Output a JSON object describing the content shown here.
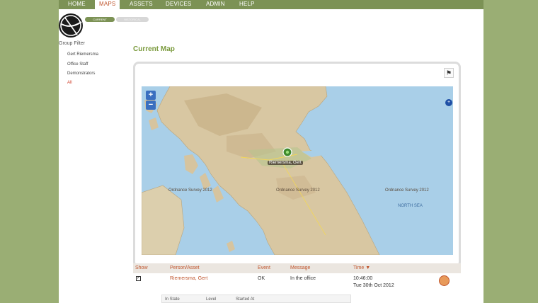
{
  "nav": {
    "items": [
      {
        "label": "HOME"
      },
      {
        "label": "MAPS"
      },
      {
        "label": "ASSETS"
      },
      {
        "label": "DEVICES"
      },
      {
        "label": "ADMIN"
      },
      {
        "label": "HELP"
      }
    ],
    "active_index": 1,
    "accent_color": "#c0562e",
    "bar_color": "#7c9255"
  },
  "view_toggle": {
    "current_label": "CURRENT",
    "historical_label": "HISTORICAL"
  },
  "group_filter": {
    "title": "Group Filter",
    "items": [
      {
        "label": "Gert Riemersma"
      },
      {
        "label": "Office Staff"
      },
      {
        "label": "Demonstrators"
      },
      {
        "label": "All"
      }
    ]
  },
  "map": {
    "title": "Current Map",
    "zoom_in": "+",
    "zoom_out": "−",
    "marker_label": "Riemersma, Gert",
    "attributions": [
      "Ordnance Survey 2012",
      "Ordnance Survey 2012",
      "Ordnance Survey 2012"
    ],
    "sea_label": "NORTH SEA",
    "layer_icon": "plus",
    "export_icon": "flag-icon"
  },
  "table": {
    "headers": {
      "show": "Show",
      "person": "Person/Asset",
      "event": "Event",
      "message": "Message",
      "time": "Time ▼"
    },
    "rows": [
      {
        "show": true,
        "person": "Riemersma, Gert",
        "event": "OK",
        "message": "In the office",
        "time": "10:46:00",
        "date": "Tue 30th Oct 2012"
      }
    ],
    "sub_headers": {
      "state": "In State",
      "level": "Level",
      "started": "Started At"
    }
  }
}
